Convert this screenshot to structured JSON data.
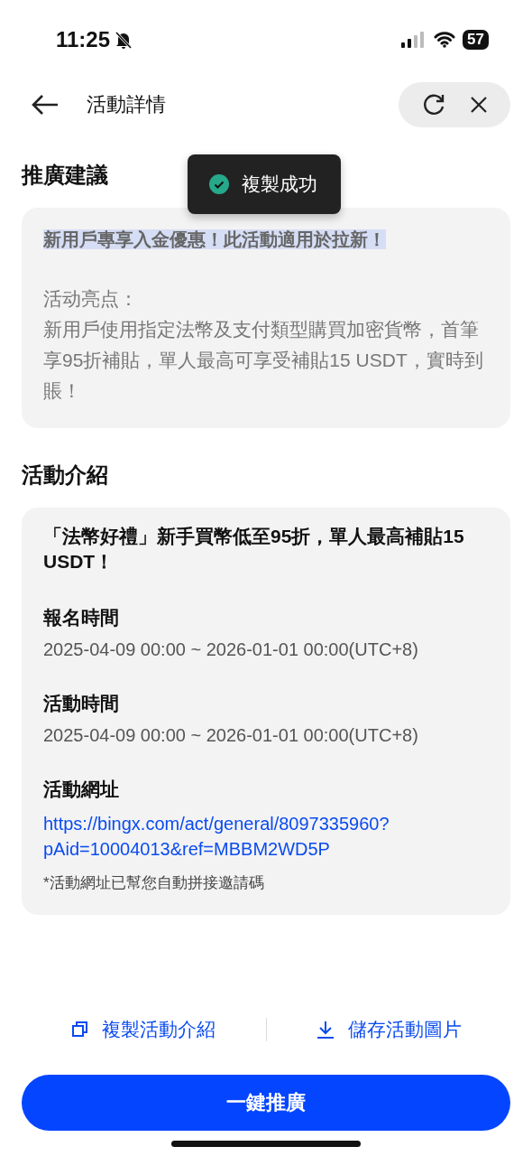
{
  "status_bar": {
    "time": "11:25",
    "battery": "57",
    "silent": true
  },
  "header": {
    "title": "活動詳情"
  },
  "toast": {
    "message": "複製成功"
  },
  "suggestion": {
    "heading": "推廣建議",
    "headline": "新用戶專享入金優惠！此活動適用於拉新！",
    "highlighted": true,
    "lines": [
      "活动亮点：",
      "新用戶使用指定法幣及支付類型購買加密貨幣，首筆享95折補貼，單人最高可享受補貼15 USDT，實時到賬！"
    ]
  },
  "intro": {
    "heading": "活動介紹",
    "title": "「法幣好禮」新手買幣低至95折，單人最高補貼15 USDT！",
    "fields": [
      {
        "kind": "text",
        "label": "報名時間",
        "value": "2025-04-09 00:00 ~ 2026-01-01 00:00(UTC+8)"
      },
      {
        "kind": "text",
        "label": "活動時間",
        "value": "2025-04-09 00:00 ~ 2026-01-01 00:00(UTC+8)"
      },
      {
        "kind": "link",
        "label": "活動網址",
        "value": "https://bingx.com/act/general/8097335960?pAid=10004013&ref=MBBM2WD5P",
        "note": "*活動網址已幫您自動拼接邀請碼"
      }
    ]
  },
  "actions": [
    {
      "kind": "copy",
      "label": "複製活動介紹"
    },
    {
      "kind": "download",
      "label": "儲存活動圖片"
    }
  ],
  "primary_button": "一鍵推廣"
}
